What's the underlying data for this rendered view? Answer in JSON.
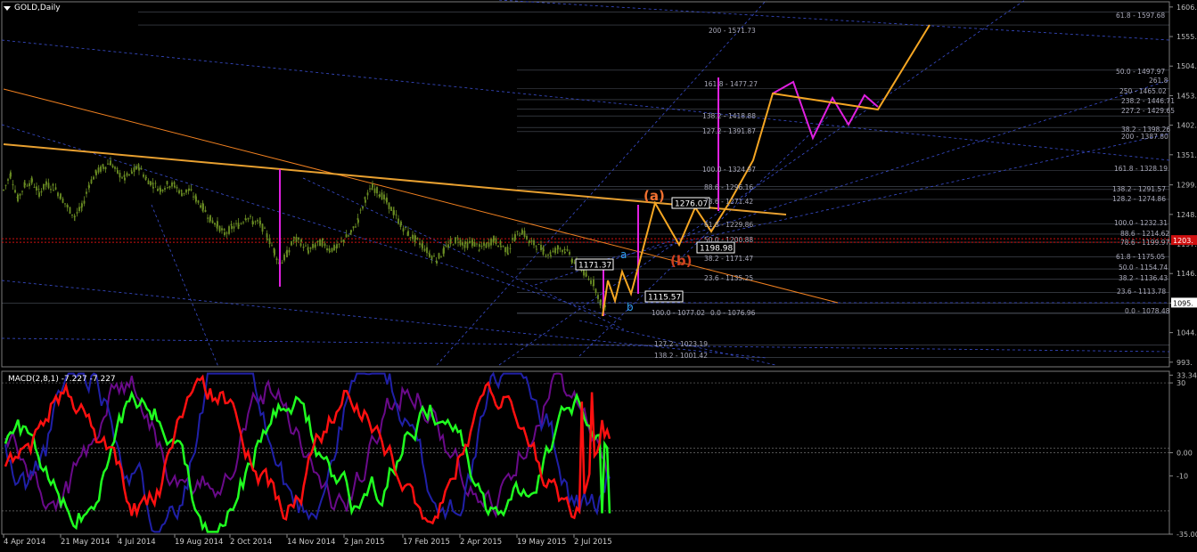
{
  "window": {
    "title": "GOLD,Daily",
    "macd_title": "MACD(2,8,1) -7.227 -7.227"
  },
  "colors": {
    "background": "#000000",
    "grid": "#3a4a66",
    "candles": "#6b8e23",
    "orange_projection": "#f5a623",
    "magenta_projection": "#e020e0",
    "fib_lines": "#8a96a8",
    "dashed_channels": "#3a4ed0",
    "trend_orange": "#f08020",
    "price_level_red": "#d01010",
    "macd_red": "#ff1010",
    "macd_green": "#20ff20",
    "macd_blue": "#2020a8",
    "macd_purple": "#6a0a8a"
  },
  "chart_data": [
    {
      "type": "line",
      "subtype": "candlestick",
      "title": "GOLD,Daily",
      "y_axis_ticks": [
        "1606.",
        "1555.",
        "1504.",
        "1453.",
        "1402.",
        "1351.",
        "1299.",
        "1248.",
        "1197.",
        "1146.",
        "1095.",
        "1044.",
        "993."
      ],
      "ylim": [
        985,
        1615
      ],
      "x_tick_labels": [
        "4 Apr 2014",
        "21 May 2014",
        "4 Jul 2014",
        "19 Aug 2014",
        "2 Oct 2014",
        "14 Nov 2014",
        "2 Jan 2015",
        "17 Feb 2015",
        "2 Apr 2015",
        "19 May 2015",
        "2 Jul 2015"
      ],
      "current_price_label": "1095.",
      "bid_label": "1203.",
      "price_path": [
        [
          0,
          1290
        ],
        [
          8,
          1318
        ],
        [
          16,
          1275
        ],
        [
          24,
          1300
        ],
        [
          32,
          1305
        ],
        [
          40,
          1285
        ],
        [
          48,
          1300
        ],
        [
          56,
          1295
        ],
        [
          64,
          1280
        ],
        [
          72,
          1260
        ],
        [
          80,
          1245
        ],
        [
          88,
          1260
        ],
        [
          96,
          1300
        ],
        [
          104,
          1320
        ],
        [
          112,
          1330
        ],
        [
          120,
          1338
        ],
        [
          128,
          1320
        ],
        [
          136,
          1310
        ],
        [
          144,
          1320
        ],
        [
          152,
          1330
        ],
        [
          160,
          1310
        ],
        [
          168,
          1300
        ],
        [
          176,
          1292
        ],
        [
          184,
          1300
        ],
        [
          192,
          1298
        ],
        [
          200,
          1285
        ],
        [
          208,
          1290
        ],
        [
          216,
          1275
        ],
        [
          224,
          1260
        ],
        [
          232,
          1240
        ],
        [
          240,
          1230
        ],
        [
          248,
          1215
        ],
        [
          256,
          1225
        ],
        [
          264,
          1230
        ],
        [
          272,
          1245
        ],
        [
          280,
          1235
        ],
        [
          288,
          1232
        ],
        [
          296,
          1210
        ],
        [
          304,
          1185
        ],
        [
          310,
          1160
        ],
        [
          318,
          1180
        ],
        [
          326,
          1205
        ],
        [
          334,
          1200
        ],
        [
          342,
          1185
        ],
        [
          350,
          1195
        ],
        [
          358,
          1200
        ],
        [
          366,
          1188
        ],
        [
          374,
          1190
        ],
        [
          382,
          1205
        ],
        [
          390,
          1215
        ],
        [
          398,
          1240
        ],
        [
          406,
          1275
        ],
        [
          414,
          1295
        ],
        [
          422,
          1285
        ],
        [
          430,
          1270
        ],
        [
          438,
          1250
        ],
        [
          446,
          1230
        ],
        [
          454,
          1215
        ],
        [
          462,
          1205
        ],
        [
          470,
          1195
        ],
        [
          478,
          1180
        ],
        [
          486,
          1170
        ],
        [
          494,
          1185
        ],
        [
          502,
          1200
        ],
        [
          510,
          1205
        ],
        [
          518,
          1195
        ],
        [
          526,
          1200
        ],
        [
          534,
          1190
        ],
        [
          542,
          1195
        ],
        [
          550,
          1205
        ],
        [
          558,
          1195
        ],
        [
          566,
          1185
        ],
        [
          574,
          1210
        ],
        [
          582,
          1220
        ],
        [
          590,
          1200
        ],
        [
          598,
          1195
        ],
        [
          606,
          1185
        ],
        [
          614,
          1180
        ],
        [
          622,
          1190
        ],
        [
          630,
          1188
        ],
        [
          638,
          1170
        ],
        [
          646,
          1160
        ],
        [
          654,
          1140
        ],
        [
          662,
          1130
        ],
        [
          670,
          1095
        ],
        [
          676,
          1085
        ]
      ],
      "annotations": [
        "(a)",
        "(b)",
        "a",
        "b",
        "1276.07",
        "1198.98",
        "1171.37",
        "1115.57"
      ],
      "fib_labels": [
        "61.8 - 1597.68",
        "200 - 1571.73",
        "50.0 - 1497.97",
        "161.8 - 1477.27",
        "261.8",
        "250 - 1465.02",
        "238.2 - 1446.71",
        "227.2 - 1429.65",
        "138.2 - 1418.88",
        "127.2 - 1391.87",
        "38.2 - 1398.26",
        "200 - 1387.80",
        "100.0 - 1324.97",
        "161.8 - 1328.19",
        "88.6 - 1296.16",
        "138.2 - 1291.57",
        "78.6 - 1271.42",
        "128.2 - 1274.86",
        "100.0 - 1232.31",
        "61.8 - 1229.86",
        "88.6 - 1214.62",
        "78.6 - 1199.97",
        "50.0 - 1200.88",
        "61.8 - 1175.05",
        "38.2 - 1171.47",
        "50.0 - 1154.74",
        "38.2 - 1136.43",
        "23.6 - 1135.25",
        "23.6 - 1113.78",
        "100.0 - 1077.02",
        "0.0 - 1076.96",
        "0.0 - 1078.48",
        "127.2 - 1023.19",
        "138.2 - 1001.42"
      ]
    },
    {
      "type": "line",
      "title": "MACD(2,8,1) -7.227 -7.227",
      "y_axis_ticks": [
        "33.34",
        "30",
        "0.00",
        "-10",
        "-35.00"
      ],
      "ylim": [
        -35,
        35
      ],
      "series": [
        {
          "name": "",
          "color": "#ff1010"
        },
        {
          "name": "",
          "color": "#20ff20"
        },
        {
          "name": "",
          "color": "#2020a8"
        },
        {
          "name": "",
          "color": "#6a0a8a"
        }
      ]
    }
  ]
}
